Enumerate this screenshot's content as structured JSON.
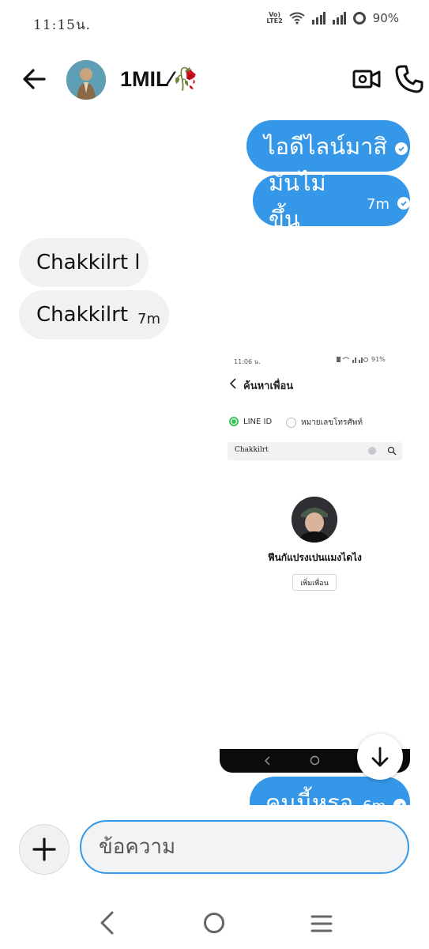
{
  "status_bar": {
    "time": "11:15น.",
    "battery": "90%",
    "volte_top": "Vo)",
    "volte_bottom": "LTE2"
  },
  "header": {
    "title": "1MIL⁄🥀",
    "avatar_icon": "avatar-image",
    "back_icon": "back-arrow-icon",
    "video_icon": "video-call-icon",
    "call_icon": "phone-icon"
  },
  "messages": [
    {
      "dir": "out",
      "text": "ไอดีไลน์มาสิ",
      "time": "",
      "seen": true
    },
    {
      "dir": "out",
      "text": "มันไม่ขึ้น",
      "time": "7m",
      "seen": true
    },
    {
      "dir": "in",
      "text": "Chakkilrt l",
      "time": ""
    },
    {
      "dir": "in",
      "text": "Chakkilrt",
      "time": "7m"
    },
    {
      "dir": "out",
      "text": "คนนี้หรอ",
      "time": "6m",
      "seen": true
    }
  ],
  "attachment": {
    "time": "11:06 น.",
    "status_right": "91%",
    "screen_title": "ค้นหาเพื่อน",
    "option_line_id": "LINE ID",
    "option_phone": "หมายเลขโทรศัพท์",
    "search_value": "Chakkilrt",
    "profile_name": "ฟีนกัแปรงเปนแมงไดไง",
    "add_friend_label": "เพิ่มเพื่อน",
    "accent": "#3ec35a"
  },
  "composer": {
    "placeholder": "ข้อความ",
    "plus_icon": "plus-icon"
  },
  "colors": {
    "outgoing": "#3497e8",
    "incoming": "#eff1f3",
    "input_border": "#3497e8"
  },
  "system_nav": {
    "back_icon": "nav-back-icon",
    "home_icon": "nav-home-icon",
    "recents_icon": "nav-recents-icon"
  }
}
